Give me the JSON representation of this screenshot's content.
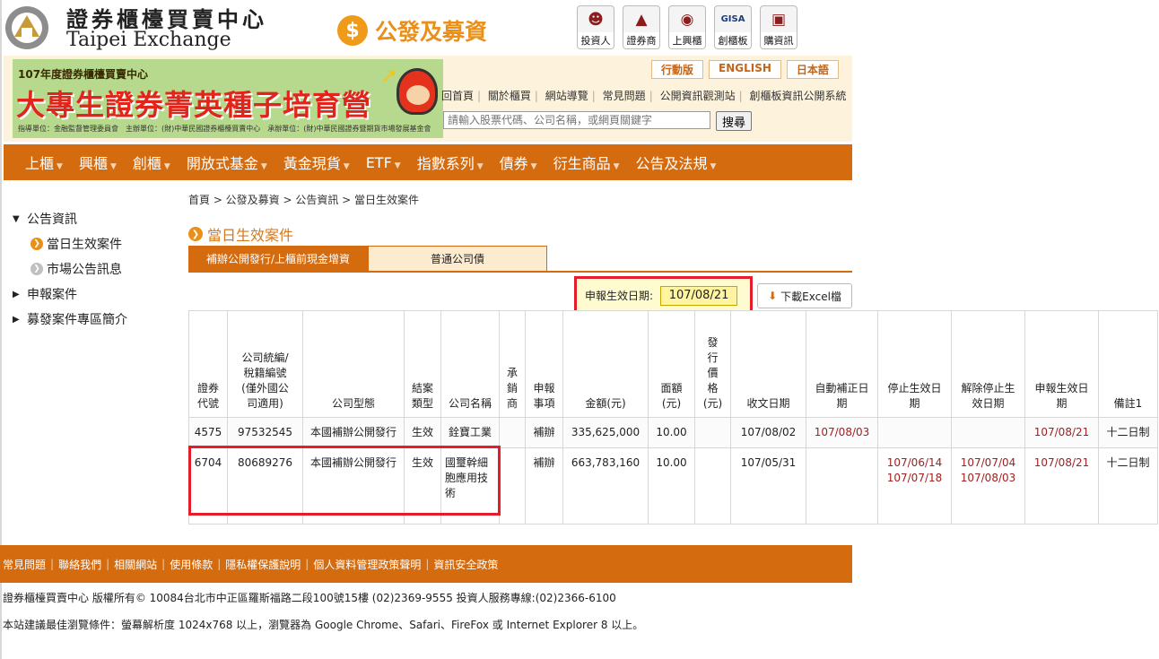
{
  "header": {
    "logo_zh": "證券櫃檯買賣中心",
    "logo_en": "Taipei Exchange",
    "section_icon": "dollar-icon",
    "section_title": "公發及募資",
    "top_icons": [
      {
        "label": "投資人",
        "icon": "investor-icon"
      },
      {
        "label": "證券商",
        "icon": "broker-icon"
      },
      {
        "label": "上興櫃",
        "icon": "globe-icon"
      },
      {
        "label": "創櫃板",
        "icon": "gisa-icon"
      },
      {
        "label": "購資訊",
        "icon": "cart-icon"
      }
    ]
  },
  "banner": {
    "line1": "107年度證券櫃檯買賣中心",
    "line2": "大專生證券菁英種子培育營",
    "line3": "指導單位：金融監督管理委員會　主辦單位：(財)中華民國證券櫃檯買賣中心　承辦單位：(財)中華民國證券暨期貨市場發展基金會"
  },
  "lang": [
    "行動版",
    "ENGLISH",
    "日本語"
  ],
  "quick_links": [
    "回首頁",
    "關於櫃買",
    "網站導覽",
    "常見問題",
    "公開資訊觀測站",
    "創櫃板資訊公開系統"
  ],
  "search": {
    "placeholder": "請輸入股票代碼、公司名稱，或網頁關鍵字",
    "button": "搜尋"
  },
  "nav": [
    "上櫃",
    "興櫃",
    "創櫃",
    "開放式基金",
    "黃金現貨",
    "ETF",
    "指數系列",
    "債券",
    "衍生商品",
    "公告及法規"
  ],
  "sidebar": {
    "groups": [
      {
        "label": "公告資訊",
        "expanded": true,
        "children": [
          {
            "label": "當日生效案件",
            "active": true
          },
          {
            "label": "市場公告訊息",
            "active": false
          }
        ]
      },
      {
        "label": "申報案件",
        "expanded": false
      },
      {
        "label": "募發案件專區簡介",
        "expanded": false
      }
    ]
  },
  "breadcrumb": "首頁 > 公發及募資 > 公告資訊 > 當日生效案件",
  "page_title": "當日生效案件",
  "tabs": [
    "補辦公開發行/上櫃前現金增資",
    "普通公司債"
  ],
  "filter": {
    "date_label": "申報生效日期:",
    "date_value": "107/08/21",
    "excel_button": "下載Excel檔"
  },
  "table": {
    "headers": [
      "證券\n代號",
      "公司統編/\n稅籍編號\n(僅外國公\n司適用)",
      "公司型態",
      "結案\n類型",
      "公司名稱",
      "承\n銷\n商",
      "申報\n事項",
      "金額(元)",
      "面額\n(元)",
      "發\n行\n價\n格\n(元)",
      "收文日期",
      "自動補正日\n期",
      "停止生效日\n期",
      "解除停止生\n效日期",
      "申報生效日\n期",
      "備註1"
    ],
    "rows": [
      [
        "4575",
        "97532545",
        "本國補辦公開發行",
        "生效",
        "銓寶工業",
        "",
        "補辦",
        "335,625,000",
        "10.00",
        "",
        "107/08/02",
        "107/08/03",
        "",
        "",
        "107/08/21",
        "十二日制"
      ],
      [
        "6704",
        "80689276",
        "本國補辦公開發行",
        "生效",
        "國璽幹細\n胞應用技\n術",
        "",
        "補辦",
        "663,783,160",
        "10.00",
        "",
        "107/05/31",
        "",
        "107/06/14\n107/07/18",
        "107/07/04\n107/08/03",
        "107/08/21",
        "十二日制"
      ]
    ]
  },
  "footer": {
    "links": [
      "常見問題",
      "聯絡我們",
      "相關網站",
      "使用條款",
      "隱私權保護說明",
      "個人資料管理政策聲明",
      "資訊安全政策"
    ],
    "copyright": "證券櫃檯買賣中心 版權所有©  10084台北市中正區羅斯福路二段100號15樓 (02)2369-9555 投資人服務專線:(02)2366-6100",
    "browser_note": "本站建議最佳瀏覽條件：螢幕解析度 1024x768 以上，瀏覽器為 Google Chrome、Safari、FireFox 或 Internet Explorer 8 以上。"
  },
  "colors": {
    "nav_orange": "#d56b0f",
    "accent_orange": "#e8901a",
    "highlight_red": "#e51c2a",
    "date_red": "#a12020"
  }
}
